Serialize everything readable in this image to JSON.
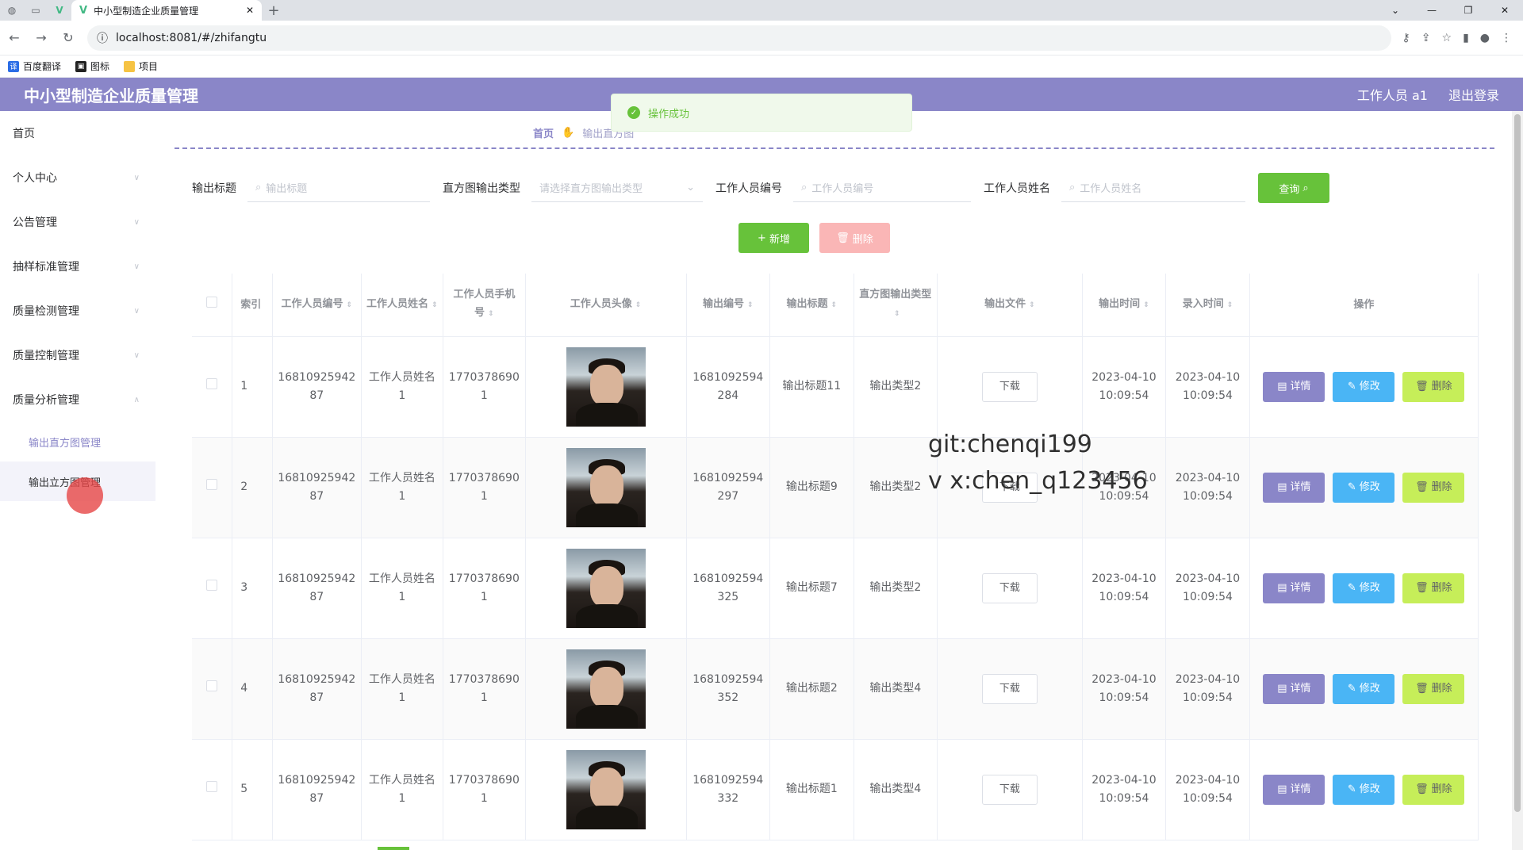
{
  "browser": {
    "tab_title": "中小型制造企业质量管理",
    "url": "localhost:8081/#/zhifangtu",
    "bookmarks": [
      "百度翻译",
      "图标",
      "项目"
    ]
  },
  "header": {
    "title": "中小型制造企业质量管理",
    "user": "工作人员 a1",
    "logout": "退出登录"
  },
  "sidebar": {
    "items": [
      {
        "label": "首页"
      },
      {
        "label": "个人中心"
      },
      {
        "label": "公告管理"
      },
      {
        "label": "抽样标准管理"
      },
      {
        "label": "质量检测管理"
      },
      {
        "label": "质量控制管理"
      },
      {
        "label": "质量分析管理"
      }
    ],
    "sub_items": [
      {
        "label": "输出直方图管理"
      },
      {
        "label": "输出立方图管理"
      }
    ]
  },
  "breadcrumb": {
    "home": "首页",
    "current": "输出直方图"
  },
  "toast": "操作成功",
  "search": {
    "title_label": "输出标题",
    "title_placeholder": "输出标题",
    "type_label": "直方图输出类型",
    "type_placeholder": "请选择直方图输出类型",
    "code_label": "工作人员编号",
    "code_placeholder": "工作人员编号",
    "name_label": "工作人员姓名",
    "name_placeholder": "工作人员姓名",
    "query_button": "查询"
  },
  "actions": {
    "add": "新增",
    "delete": "删除"
  },
  "table": {
    "headers": {
      "index": "索引",
      "staff_code": "工作人员编号",
      "staff_name": "工作人员姓名",
      "staff_phone": "工作人员手机号",
      "staff_avatar": "工作人员头像",
      "output_code": "输出编号",
      "output_title": "输出标题",
      "hist_type": "直方图输出类型",
      "output_file": "输出文件",
      "output_time": "输出时间",
      "entry_time": "录入时间",
      "ops": "操作"
    },
    "download_label": "下载",
    "op_labels": {
      "detail": "详情",
      "edit": "修改",
      "remove": "删除"
    },
    "rows": [
      {
        "index": "1",
        "staff_code": "1681092594287",
        "staff_name": "工作人员姓名1",
        "staff_phone": "17703786901",
        "output_code": "1681092594284",
        "output_title": "输出标题11",
        "hist_type": "输出类型2",
        "output_time": "2023-04-10 10:09:54",
        "entry_time": "2023-04-10 10:09:54"
      },
      {
        "index": "2",
        "staff_code": "1681092594287",
        "staff_name": "工作人员姓名1",
        "staff_phone": "17703786901",
        "output_code": "1681092594297",
        "output_title": "输出标题9",
        "hist_type": "输出类型2",
        "output_time": "2023-04-10 10:09:54",
        "entry_time": "2023-04-10 10:09:54"
      },
      {
        "index": "3",
        "staff_code": "1681092594287",
        "staff_name": "工作人员姓名1",
        "staff_phone": "17703786901",
        "output_code": "1681092594325",
        "output_title": "输出标题7",
        "hist_type": "输出类型2",
        "output_time": "2023-04-10 10:09:54",
        "entry_time": "2023-04-10 10:09:54"
      },
      {
        "index": "4",
        "staff_code": "1681092594287",
        "staff_name": "工作人员姓名1",
        "staff_phone": "17703786901",
        "output_code": "1681092594352",
        "output_title": "输出标题2",
        "hist_type": "输出类型4",
        "output_time": "2023-04-10 10:09:54",
        "entry_time": "2023-04-10 10:09:54"
      },
      {
        "index": "5",
        "staff_code": "1681092594287",
        "staff_name": "工作人员姓名1",
        "staff_phone": "17703786901",
        "output_code": "1681092594332",
        "output_title": "输出标题1",
        "hist_type": "输出类型4",
        "output_time": "2023-04-10 10:09:54",
        "entry_time": "2023-04-10 10:09:54"
      }
    ]
  },
  "watermark": [
    "git:chenqi199",
    "v x:chen_q123456"
  ],
  "colors": {
    "accent": "#8a86c8",
    "success": "#67c23a",
    "danger_light": "#fab6b6",
    "info": "#4ab5f5",
    "lime": "#c6ee59"
  }
}
